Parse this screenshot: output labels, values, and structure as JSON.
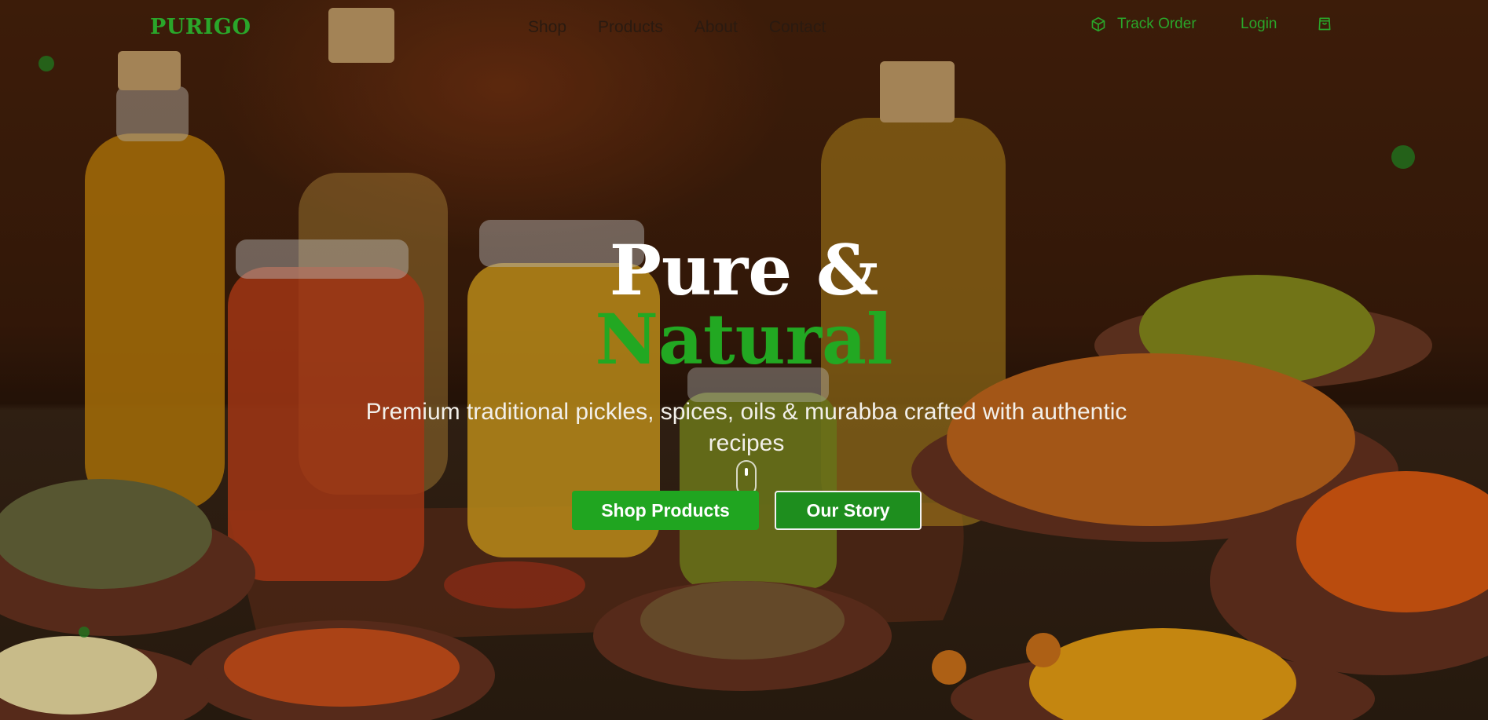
{
  "nav": {
    "logo": "PURIGO",
    "links": [
      "Shop",
      "Products",
      "About",
      "Contact"
    ],
    "track_order": "Track Order",
    "login": "Login"
  },
  "hero": {
    "title_line1": "Pure &",
    "title_line2": "Natural",
    "subtitle": "Premium traditional pickles, spices, oils & murabba crafted with authentic recipes",
    "primary_button": "Shop Products",
    "secondary_button": "Our Story"
  },
  "icons": {
    "track_order": "package-icon",
    "cart": "shopping-bag-icon",
    "scroll": "mouse-scroll-icon"
  },
  "colors": {
    "brand_green": "#2aa62a",
    "title_green": "#22a822",
    "button_green": "#20a520",
    "text_dark": "#2a1a10",
    "background": "#3d1d0a"
  }
}
